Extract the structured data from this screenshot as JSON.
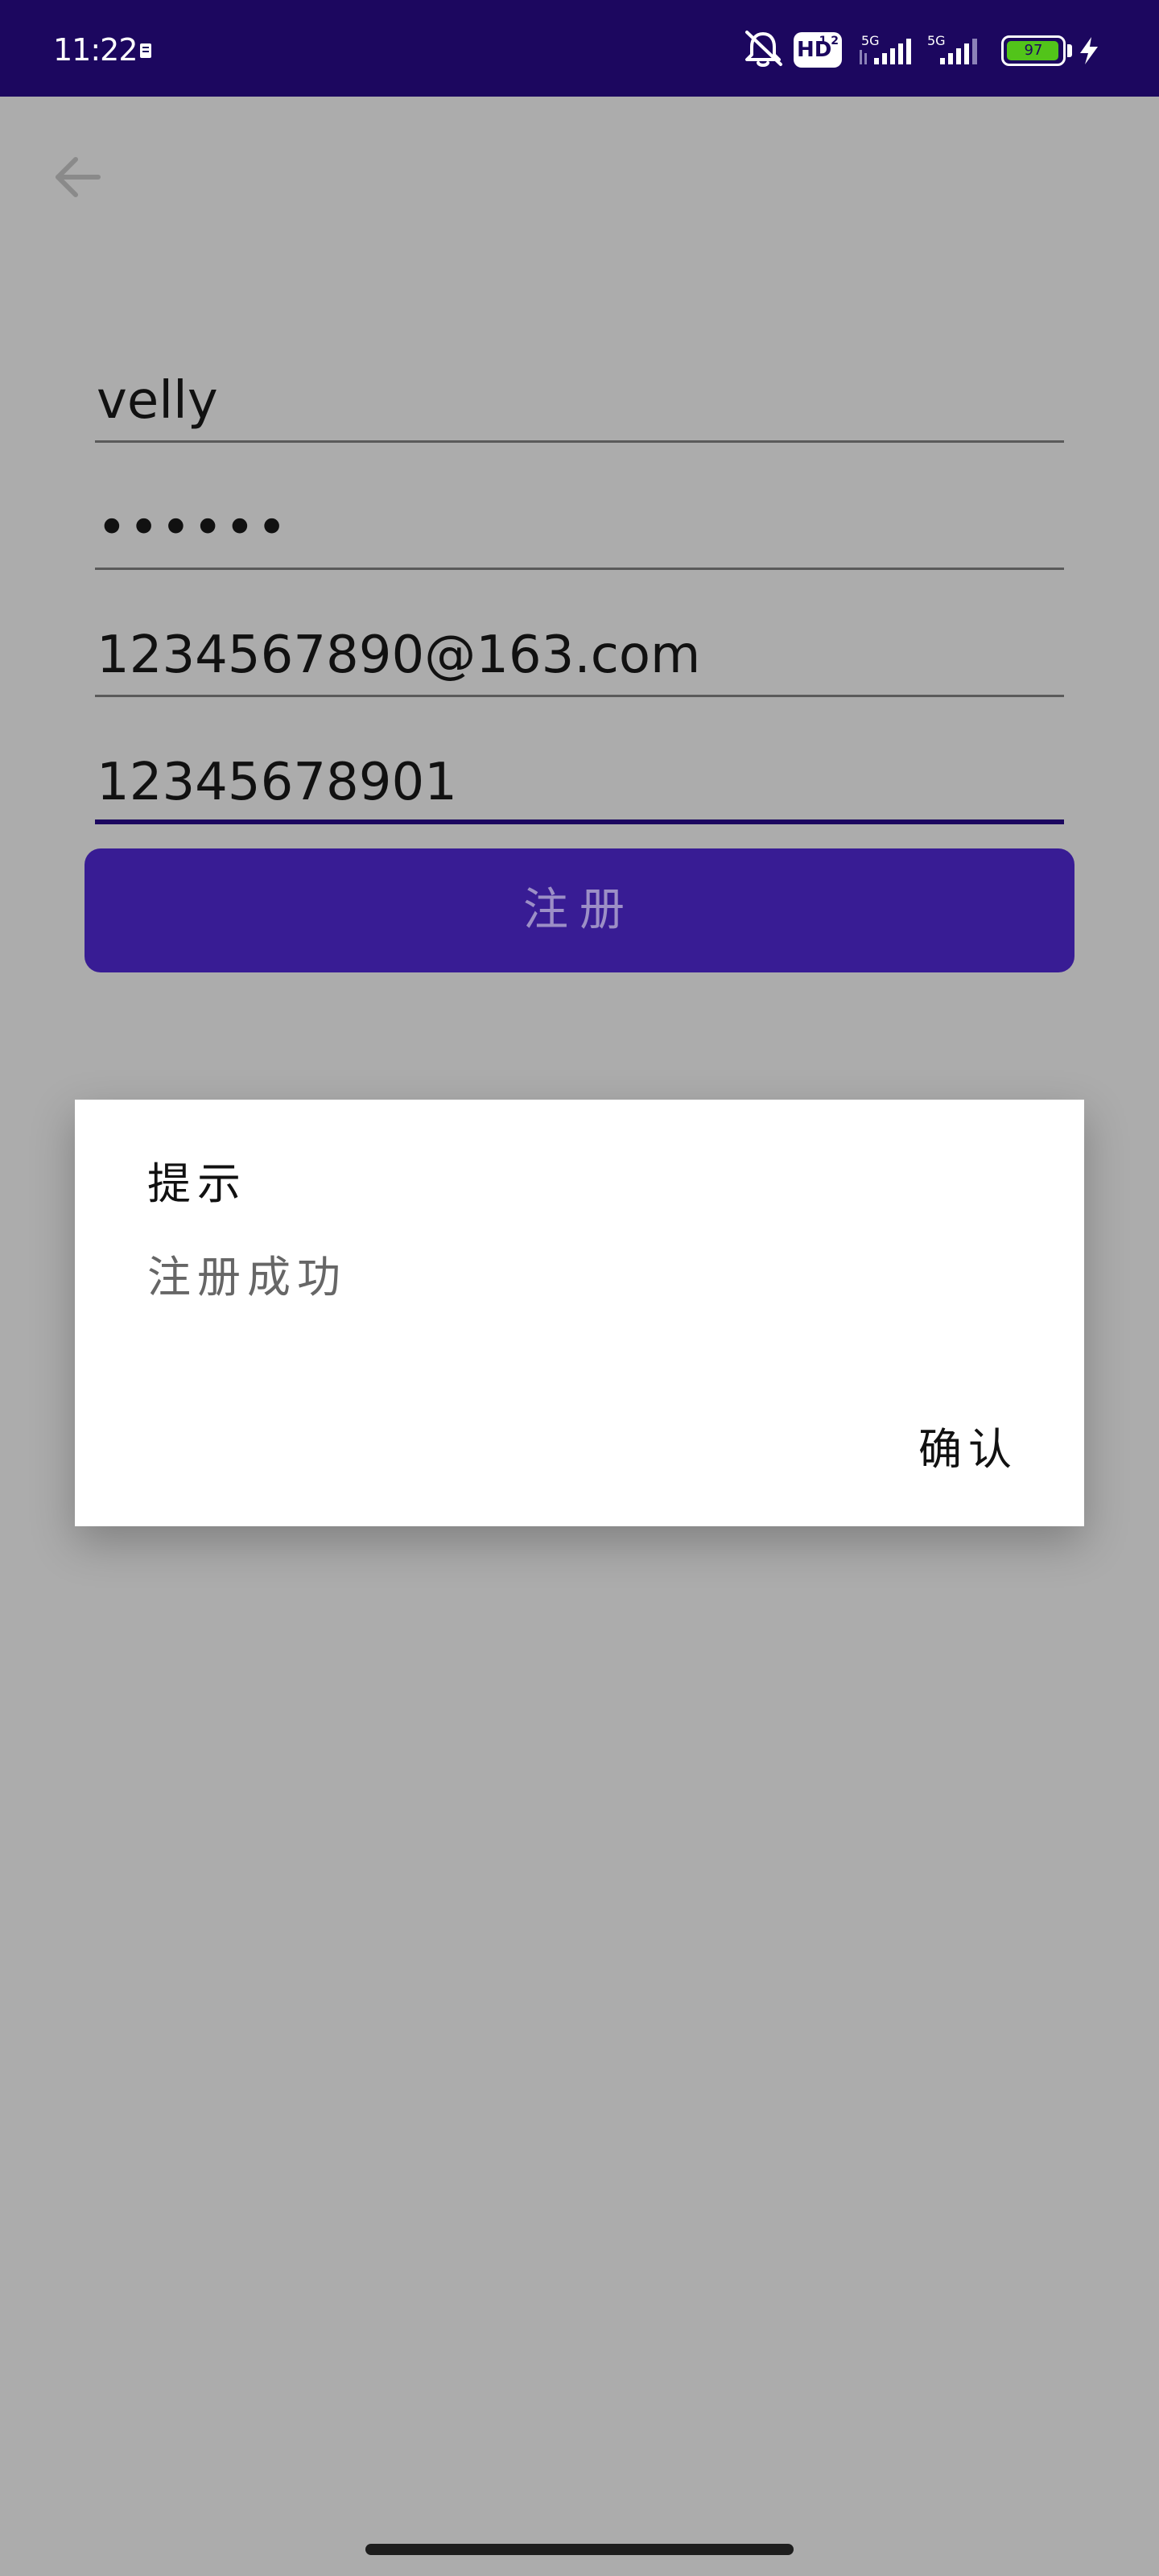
{
  "status_bar": {
    "time": "11:22",
    "hd_label": "HD",
    "hd_sub": "1 2",
    "network_label": "5G",
    "battery_level": "97",
    "battery_fraction": 0.97,
    "icons": [
      "notification-icon",
      "mute-icon",
      "hd-icon",
      "signal-icon",
      "signal-icon",
      "battery-icon",
      "charging-icon"
    ]
  },
  "toolbar": {
    "back_icon": "arrow-left-icon"
  },
  "form": {
    "username_value": "velly",
    "password_value": "••••••",
    "email_value": "1234567890@163.com",
    "phone_value": "12345678901",
    "register_label": "注册"
  },
  "dialog": {
    "title": "提示",
    "message": "注册成功",
    "confirm_label": "确认"
  },
  "colors": {
    "status_bar_bg": "#1c075f",
    "scrim": "#acacac",
    "button_bg": "#381c94",
    "battery_green": "#52c41a"
  }
}
